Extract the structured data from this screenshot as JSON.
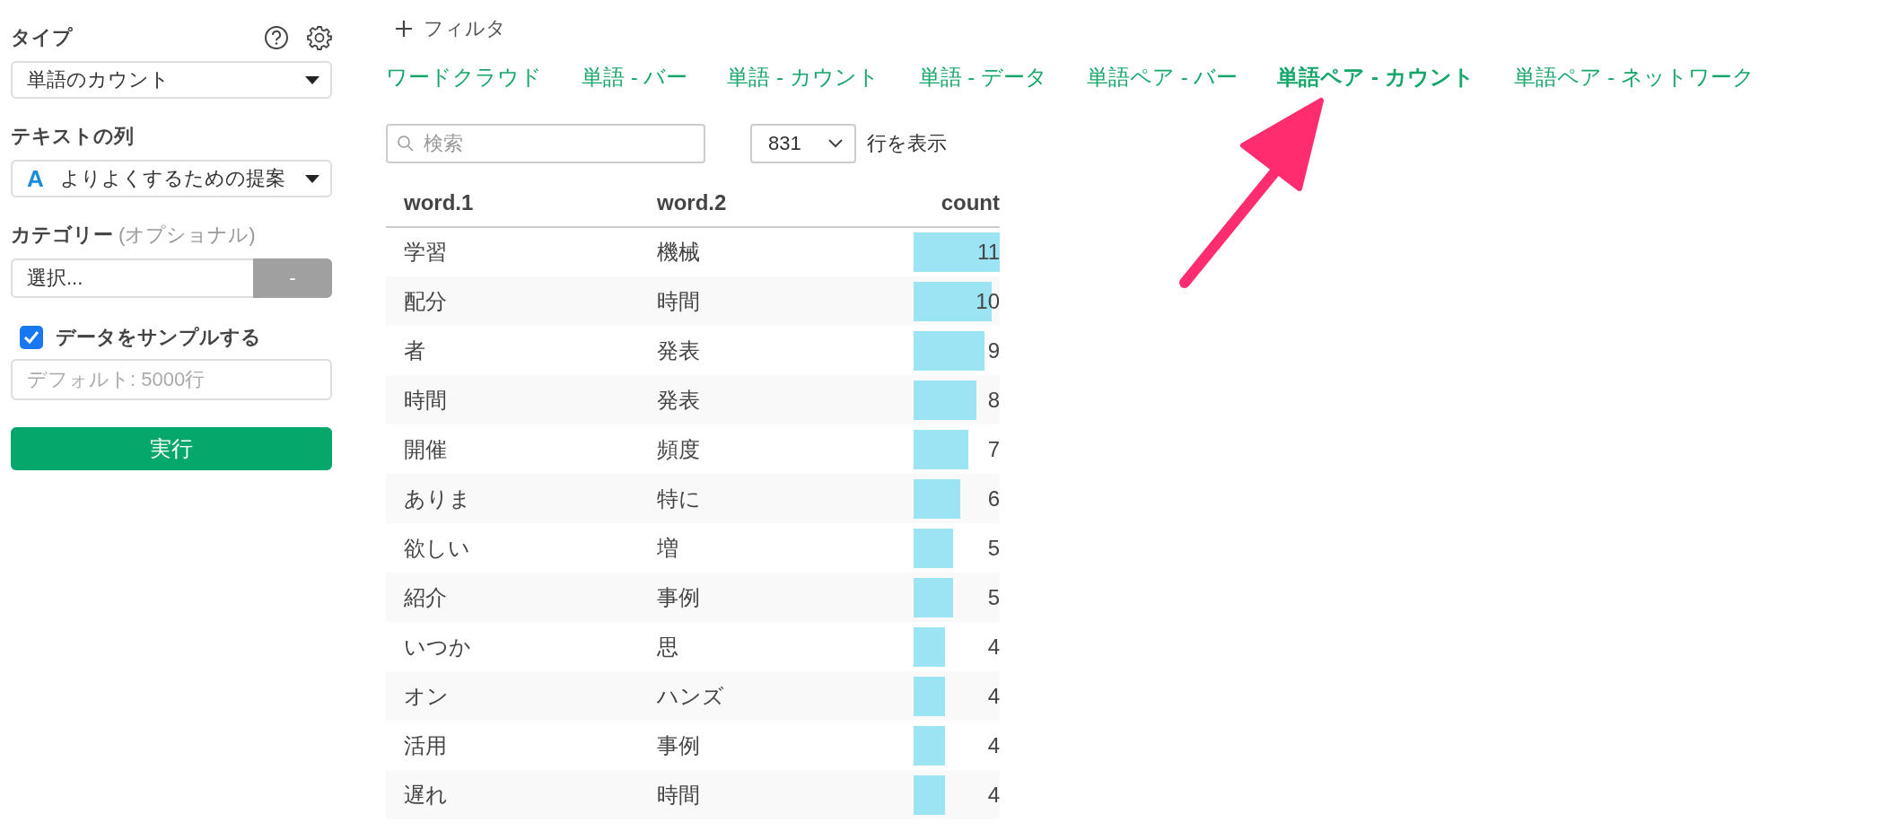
{
  "sidebar": {
    "type_label": "タイプ",
    "type_select": {
      "value": "単語のカウント"
    },
    "text_column_label": "テキストの列",
    "text_column_select": {
      "type_icon": "A",
      "value": "よりよくするための提案"
    },
    "category_label": "カテゴリー",
    "category_hint": "(オプショナル)",
    "category_select": {
      "placeholder": "選択..."
    },
    "category_button": "-",
    "sample": {
      "label": "データをサンプルする",
      "checked": true
    },
    "sample_size": {
      "placeholder": "デフォルト: 5000行"
    },
    "run_button": "実行"
  },
  "filter_button": "フィルタ",
  "tabs": [
    {
      "label": "ワードクラウド",
      "selected": false
    },
    {
      "label": "単語 - バー",
      "selected": false
    },
    {
      "label": "単語 - カウント",
      "selected": false
    },
    {
      "label": "単語 - データ",
      "selected": false
    },
    {
      "label": "単語ペア - バー",
      "selected": false
    },
    {
      "label": "単語ペア - カウント",
      "selected": true
    },
    {
      "label": "単語ペア - ネットワーク",
      "selected": false
    }
  ],
  "search": {
    "placeholder": "検索"
  },
  "page_size": {
    "value": "831"
  },
  "page_size_label": "行を表示",
  "table": {
    "columns": [
      "word.1",
      "word.2",
      "count"
    ],
    "rows": [
      {
        "word_1": "学習",
        "word_2": "機械",
        "count": "11",
        "level": 1
      },
      {
        "word_1": "配分",
        "word_2": "時間",
        "count": "10",
        "level": 0.909
      },
      {
        "word_1": "者",
        "word_2": "発表",
        "count": "9",
        "level": 0.818
      },
      {
        "word_1": "時間",
        "word_2": "発表",
        "count": "8",
        "level": 0.727
      },
      {
        "word_1": "開催",
        "word_2": "頻度",
        "count": "7",
        "level": 0.636
      },
      {
        "word_1": "ありま",
        "word_2": "特に",
        "count": "6",
        "level": 0.545
      },
      {
        "word_1": "欲しい",
        "word_2": "増",
        "count": "5",
        "level": 0.455
      },
      {
        "word_1": "紹介",
        "word_2": "事例",
        "count": "5",
        "level": 0.455
      },
      {
        "word_1": "いつか",
        "word_2": "思",
        "count": "4",
        "level": 0.364
      },
      {
        "word_1": "オン",
        "word_2": "ハンズ",
        "count": "4",
        "level": 0.364
      },
      {
        "word_1": "活用",
        "word_2": "事例",
        "count": "4",
        "level": 0.364
      },
      {
        "word_1": "遅れ",
        "word_2": "時間",
        "count": "4",
        "level": 0.364
      }
    ]
  }
}
